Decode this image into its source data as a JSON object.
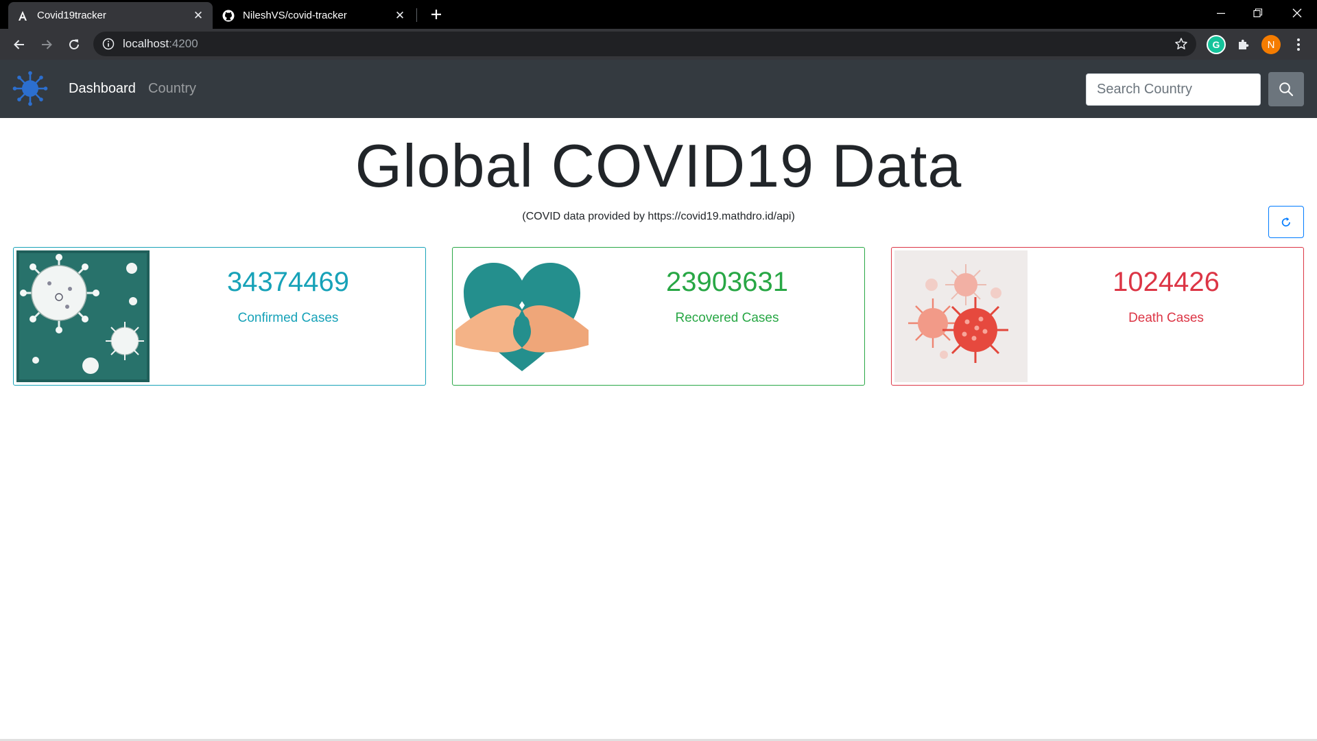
{
  "browser": {
    "tabs": [
      {
        "title": "Covid19tracker",
        "icon": "angular-logo-icon",
        "active": true
      },
      {
        "title": "NileshVS/covid-tracker",
        "icon": "github-logo-icon",
        "active": false
      }
    ],
    "url_host": "localhost",
    "url_port": ":4200",
    "profile_initial": "N",
    "extension_initial": "G"
  },
  "navbar": {
    "brand_icon": "virus-logo-icon",
    "links": [
      {
        "label": "Dashboard",
        "active": true
      },
      {
        "label": "Country",
        "active": false
      }
    ],
    "search_placeholder": "Search Country",
    "search_icon": "search-icon"
  },
  "main": {
    "title": "Global COVID19 Data",
    "source_note": "(COVID data provided by https://covid19.mathdro.id/api)",
    "refresh_icon": "refresh-icon"
  },
  "cards": [
    {
      "value": "34374469",
      "label": "Confirmed Cases",
      "color": "#17a2b8",
      "image": "virus-sketch-image"
    },
    {
      "value": "23903631",
      "label": "Recovered Cases",
      "color": "#28a745",
      "image": "heart-hands-image"
    },
    {
      "value": "1024426",
      "label": "Death Cases",
      "color": "#dc3545",
      "image": "red-virus-image"
    }
  ]
}
